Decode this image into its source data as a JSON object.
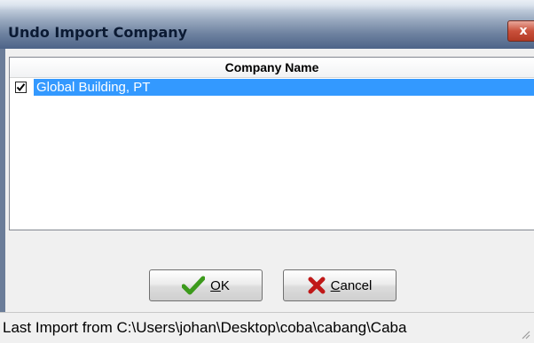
{
  "window": {
    "title": "Undo Import Company",
    "close_glyph": "x",
    "close_icon": "close-icon"
  },
  "list": {
    "column_header": "Company Name",
    "rows": [
      {
        "checked": true,
        "label": "Global Building, PT",
        "selected": true
      }
    ]
  },
  "buttons": {
    "ok": {
      "label_underlined": "O",
      "label_rest": "K",
      "icon": "checkmark-icon"
    },
    "cancel": {
      "label_underlined": "C",
      "label_rest": "ancel",
      "icon": "cross-icon"
    }
  },
  "status_bar": {
    "text": "Last Import from C:\\Users\\johan\\Desktop\\coba\\cabang\\Caba"
  },
  "colors": {
    "selection": "#3399ff",
    "ok_icon": "#3c9a1c",
    "cancel_icon": "#c01818"
  }
}
